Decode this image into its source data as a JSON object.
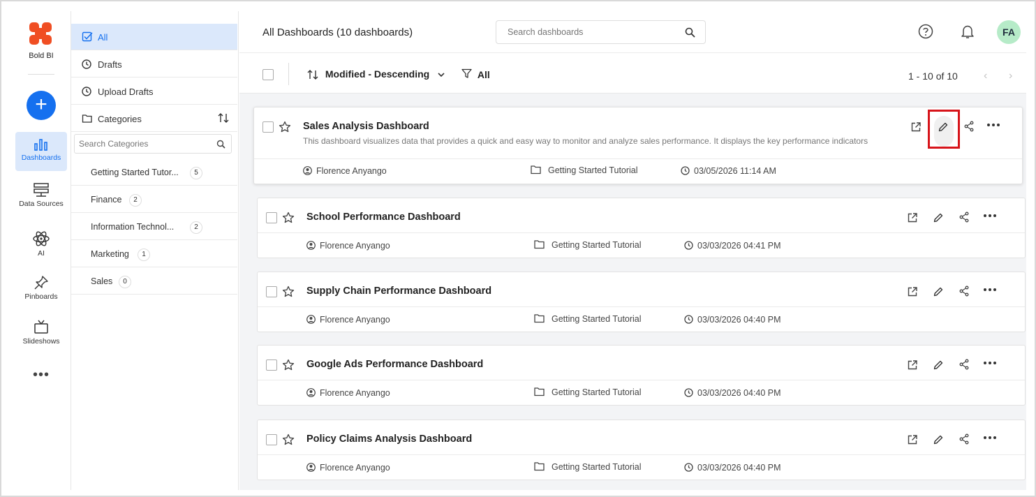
{
  "brand": {
    "name": "Bold BI",
    "accent": "#1570ef",
    "logo_color": "#f04e23"
  },
  "nav": {
    "items": [
      {
        "label": "Dashboards",
        "icon": "bar-chart-icon",
        "active": true
      },
      {
        "label": "Data Sources",
        "icon": "server-icon",
        "active": false
      },
      {
        "label": "AI",
        "icon": "atom-icon",
        "active": false
      },
      {
        "label": "Pinboards",
        "icon": "pin-icon",
        "active": false
      },
      {
        "label": "Slideshows",
        "icon": "tv-icon",
        "active": false
      }
    ],
    "more": "•••"
  },
  "categories": {
    "all": "All",
    "drafts": "Drafts",
    "upload_drafts": "Upload Drafts",
    "header": "Categories",
    "search_placeholder": "Search Categories",
    "list": [
      {
        "label": "Getting Started Tutor...",
        "count": "5"
      },
      {
        "label": "Finance",
        "count": "2"
      },
      {
        "label": "Information Technol...",
        "count": "2"
      },
      {
        "label": "Marketing",
        "count": "1"
      },
      {
        "label": "Sales",
        "count": "0"
      }
    ]
  },
  "header": {
    "title": "All Dashboards (10 dashboards)",
    "search_placeholder": "Search dashboards",
    "avatar_initials": "FA"
  },
  "toolbar": {
    "sort_label": "Modified - Descending",
    "filter_label": "All",
    "pagination": "1 - 10 of 10"
  },
  "dashboards": [
    {
      "title": "Sales Analysis Dashboard",
      "description": "This dashboard visualizes data that provides a quick and easy way to monitor and analyze sales performance. It displays the key performance indicators",
      "owner": "Florence Anyango",
      "category": "Getting Started Tutorial",
      "modified": "03/05/2026 11:14 AM"
    },
    {
      "title": "School Performance Dashboard",
      "owner": "Florence Anyango",
      "category": "Getting Started Tutorial",
      "modified": "03/03/2026 04:41 PM"
    },
    {
      "title": "Supply Chain Performance Dashboard",
      "owner": "Florence Anyango",
      "category": "Getting Started Tutorial",
      "modified": "03/03/2026 04:40 PM"
    },
    {
      "title": "Google Ads Performance Dashboard",
      "owner": "Florence Anyango",
      "category": "Getting Started Tutorial",
      "modified": "03/03/2026 04:40 PM"
    },
    {
      "title": "Policy Claims Analysis Dashboard",
      "owner": "Florence Anyango",
      "category": "Getting Started Tutorial",
      "modified": "03/03/2026 04:40 PM"
    }
  ],
  "highlight_color": "#d7141a"
}
